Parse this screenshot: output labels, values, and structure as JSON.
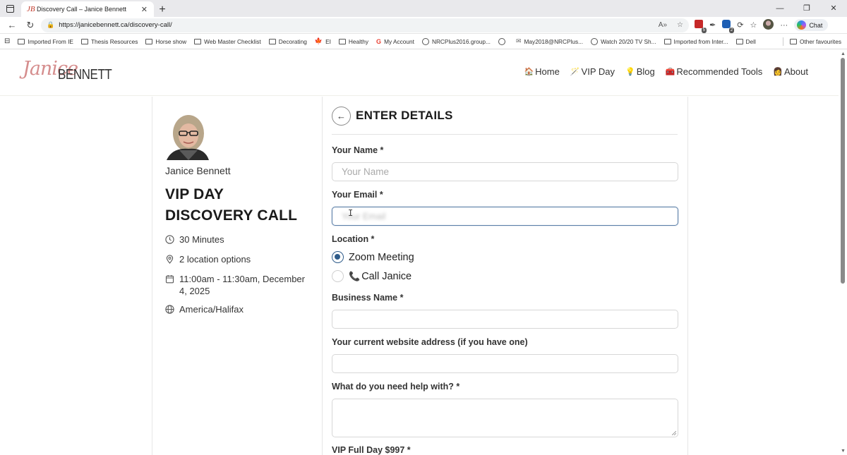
{
  "browser": {
    "tab_title": "Discovery Call – Janice Bennett",
    "tab_favicon": "JB",
    "url": "https://janicebennett.ca/discovery-call/",
    "chat_label": "Chat",
    "bookmarks": [
      {
        "label": "Imported From IE",
        "icon": "folder"
      },
      {
        "label": "Thesis Resources",
        "icon": "folder"
      },
      {
        "label": "Horse show",
        "icon": "folder"
      },
      {
        "label": "Web Master Checklist",
        "icon": "folder"
      },
      {
        "label": "Decorating",
        "icon": "folder"
      },
      {
        "label": "EI",
        "icon": "maple-leaf"
      },
      {
        "label": "Healthy",
        "icon": "folder"
      },
      {
        "label": "My Account",
        "icon": "google"
      },
      {
        "label": "NRCPlus2016.group...",
        "icon": "globe"
      },
      {
        "label": "",
        "icon": "globe"
      },
      {
        "label": "May2018@NRCPlus...",
        "icon": "mail"
      },
      {
        "label": "Watch 20/20 TV Sh...",
        "icon": "globe"
      },
      {
        "label": "Imported from Inter...",
        "icon": "folder"
      },
      {
        "label": "Dell",
        "icon": "folder"
      }
    ],
    "other_favourites": "Other favourites",
    "ext_badge_1": "5",
    "ext_badge_2": "2"
  },
  "site": {
    "logo_script": "Janice",
    "logo_word": "BENNETT",
    "nav": [
      {
        "label": "Home",
        "icon": "🏠"
      },
      {
        "label": "VIP Day",
        "icon": "🪄"
      },
      {
        "label": "Blog",
        "icon": "💡"
      },
      {
        "label": "Recommended Tools",
        "icon": "🧰"
      },
      {
        "label": "About",
        "icon": "👩"
      }
    ]
  },
  "event": {
    "host_name": "Janice Bennett",
    "title_line1": "VIP DAY",
    "title_line2": "DISCOVERY CALL",
    "duration": "30 Minutes",
    "locations": "2 location options",
    "datetime": "11:00am - 11:30am, December 4, 2025",
    "timezone": "America/Halifax"
  },
  "form": {
    "heading": "ENTER DETAILS",
    "name_label": "Your Name *",
    "name_placeholder": "Your Name",
    "email_label": "Your Email *",
    "email_value": "Your Email",
    "location_label": "Location *",
    "location_options": [
      {
        "label": "Zoom Meeting",
        "selected": true
      },
      {
        "label": "Call Janice",
        "selected": false
      }
    ],
    "business_label": "Business Name *",
    "website_label": "Your current website address (if you have one)",
    "help_label": "What do you need help with? *",
    "vip_label": "VIP Full Day $997 *"
  }
}
